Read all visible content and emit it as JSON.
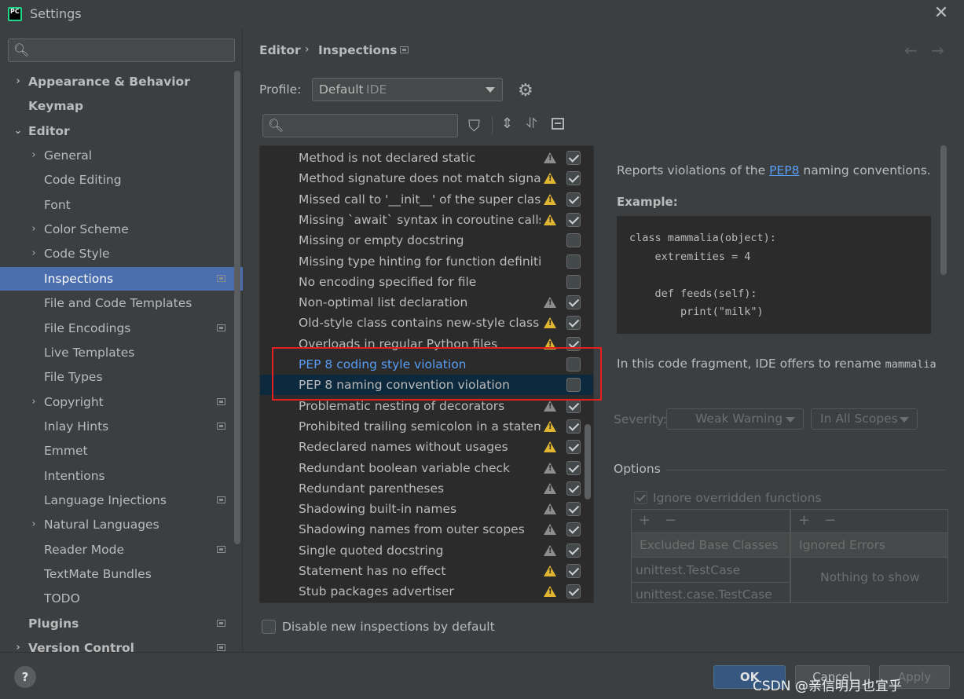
{
  "window": {
    "title": "Settings",
    "icon_text": "PC",
    "close": "✕"
  },
  "sidebar": {
    "search_placeholder": "",
    "items": [
      {
        "label": "Appearance & Behavior",
        "level": 0,
        "bold": true,
        "chevron": "›",
        "proj": false
      },
      {
        "label": "Keymap",
        "level": 0,
        "bold": true,
        "chevron": "",
        "proj": false
      },
      {
        "label": "Editor",
        "level": 0,
        "bold": true,
        "chevron": "⌄",
        "proj": false
      },
      {
        "label": "General",
        "level": 1,
        "bold": false,
        "chevron": "›",
        "proj": false
      },
      {
        "label": "Code Editing",
        "level": 1,
        "bold": false,
        "chevron": "",
        "proj": false
      },
      {
        "label": "Font",
        "level": 1,
        "bold": false,
        "chevron": "",
        "proj": false
      },
      {
        "label": "Color Scheme",
        "level": 1,
        "bold": false,
        "chevron": "›",
        "proj": false
      },
      {
        "label": "Code Style",
        "level": 1,
        "bold": false,
        "chevron": "›",
        "proj": false
      },
      {
        "label": "Inspections",
        "level": 1,
        "bold": false,
        "chevron": "",
        "proj": true,
        "selected": true
      },
      {
        "label": "File and Code Templates",
        "level": 1,
        "bold": false,
        "chevron": "",
        "proj": false
      },
      {
        "label": "File Encodings",
        "level": 1,
        "bold": false,
        "chevron": "",
        "proj": true
      },
      {
        "label": "Live Templates",
        "level": 1,
        "bold": false,
        "chevron": "",
        "proj": false
      },
      {
        "label": "File Types",
        "level": 1,
        "bold": false,
        "chevron": "",
        "proj": false
      },
      {
        "label": "Copyright",
        "level": 1,
        "bold": false,
        "chevron": "›",
        "proj": true
      },
      {
        "label": "Inlay Hints",
        "level": 1,
        "bold": false,
        "chevron": "",
        "proj": true
      },
      {
        "label": "Emmet",
        "level": 1,
        "bold": false,
        "chevron": "",
        "proj": false
      },
      {
        "label": "Intentions",
        "level": 1,
        "bold": false,
        "chevron": "",
        "proj": false
      },
      {
        "label": "Language Injections",
        "level": 1,
        "bold": false,
        "chevron": "",
        "proj": true
      },
      {
        "label": "Natural Languages",
        "level": 1,
        "bold": false,
        "chevron": "›",
        "proj": false
      },
      {
        "label": "Reader Mode",
        "level": 1,
        "bold": false,
        "chevron": "",
        "proj": true
      },
      {
        "label": "TextMate Bundles",
        "level": 1,
        "bold": false,
        "chevron": "",
        "proj": false
      },
      {
        "label": "TODO",
        "level": 1,
        "bold": false,
        "chevron": "",
        "proj": false
      },
      {
        "label": "Plugins",
        "level": 0,
        "bold": true,
        "chevron": "",
        "proj": true
      },
      {
        "label": "Version Control",
        "level": 0,
        "bold": true,
        "chevron": "›",
        "proj": true
      }
    ]
  },
  "header": {
    "breadcrumb_editor": "Editor",
    "breadcrumb_sep": "›",
    "breadcrumb_inspections": "Inspections",
    "nav_back": "←",
    "nav_forward": "→"
  },
  "profile": {
    "label": "Profile:",
    "name": "Default",
    "scope": "IDE"
  },
  "inspections": [
    {
      "text": "Method is not declared static",
      "warn": "grey",
      "checked": true
    },
    {
      "text": "Method signature does not match signature",
      "warn": "yellow",
      "checked": true
    },
    {
      "text": "Missed call to '__init__' of the super class",
      "warn": "yellow",
      "checked": true
    },
    {
      "text": "Missing `await` syntax in coroutine calls",
      "warn": "yellow",
      "checked": true
    },
    {
      "text": "Missing or empty docstring",
      "warn": "",
      "checked": false
    },
    {
      "text": "Missing type hinting for function definition",
      "warn": "",
      "checked": false
    },
    {
      "text": "No encoding specified for file",
      "warn": "",
      "checked": false
    },
    {
      "text": "Non-optimal list declaration",
      "warn": "grey",
      "checked": true
    },
    {
      "text": "Old-style class contains new-style class features",
      "warn": "yellow",
      "checked": true
    },
    {
      "text": "Overloads in regular Python files",
      "warn": "yellow",
      "checked": true
    },
    {
      "text": "PEP 8 coding style violation",
      "warn": "",
      "checked": false,
      "modified": true
    },
    {
      "text": "PEP 8 naming convention violation",
      "warn": "",
      "checked": false,
      "selected": true
    },
    {
      "text": "Problematic nesting of decorators",
      "warn": "grey",
      "checked": true
    },
    {
      "text": "Prohibited trailing semicolon in a statement",
      "warn": "yellow",
      "checked": true
    },
    {
      "text": "Redeclared names without usages",
      "warn": "yellow",
      "checked": true
    },
    {
      "text": "Redundant boolean variable check",
      "warn": "grey",
      "checked": true
    },
    {
      "text": "Redundant parentheses",
      "warn": "grey",
      "checked": true
    },
    {
      "text": "Shadowing built-in names",
      "warn": "grey",
      "checked": true
    },
    {
      "text": "Shadowing names from outer scopes",
      "warn": "grey",
      "checked": true
    },
    {
      "text": "Single quoted docstring",
      "warn": "grey",
      "checked": true
    },
    {
      "text": "Statement has no effect",
      "warn": "yellow",
      "checked": true
    },
    {
      "text": "Stub packages advertiser",
      "warn": "yellow",
      "checked": true
    }
  ],
  "description": {
    "intro_before": "Reports violations of the ",
    "intro_link": "PEP8",
    "intro_after": " naming conventions.",
    "example_label": "Example:",
    "code": [
      "class mammalia(object):",
      "    extremities = 4",
      "",
      "    def feeds(self):",
      "        print(\"milk\")"
    ],
    "rename_text": "In this code fragment, IDE offers to rename ",
    "rename_code": "mammalia"
  },
  "severity": {
    "label": "Severity:",
    "value": "Weak Warning",
    "scope": "In All Scopes"
  },
  "options": {
    "label": "Options",
    "ignore_overridden": "Ignore overridden functions",
    "excluded_header": "Excluded Base Classes",
    "excluded_rows": [
      "unittest.TestCase",
      "unittest.case.TestCase"
    ],
    "ignored_header": "Ignored Errors",
    "ignored_empty": "Nothing to show",
    "add": "+",
    "remove": "−"
  },
  "footer": {
    "disable_label": "Disable new inspections by default",
    "help": "?",
    "ok": "OK",
    "cancel": "Cancel",
    "apply": "Apply",
    "watermark": "CSDN @亲信明月也宜乎"
  },
  "colors": {
    "accent": "#4b6eaf",
    "selected_row": "#0d293e",
    "link": "#589df6",
    "warning_yellow": "#e0b532",
    "highlight_box": "#e22020"
  }
}
